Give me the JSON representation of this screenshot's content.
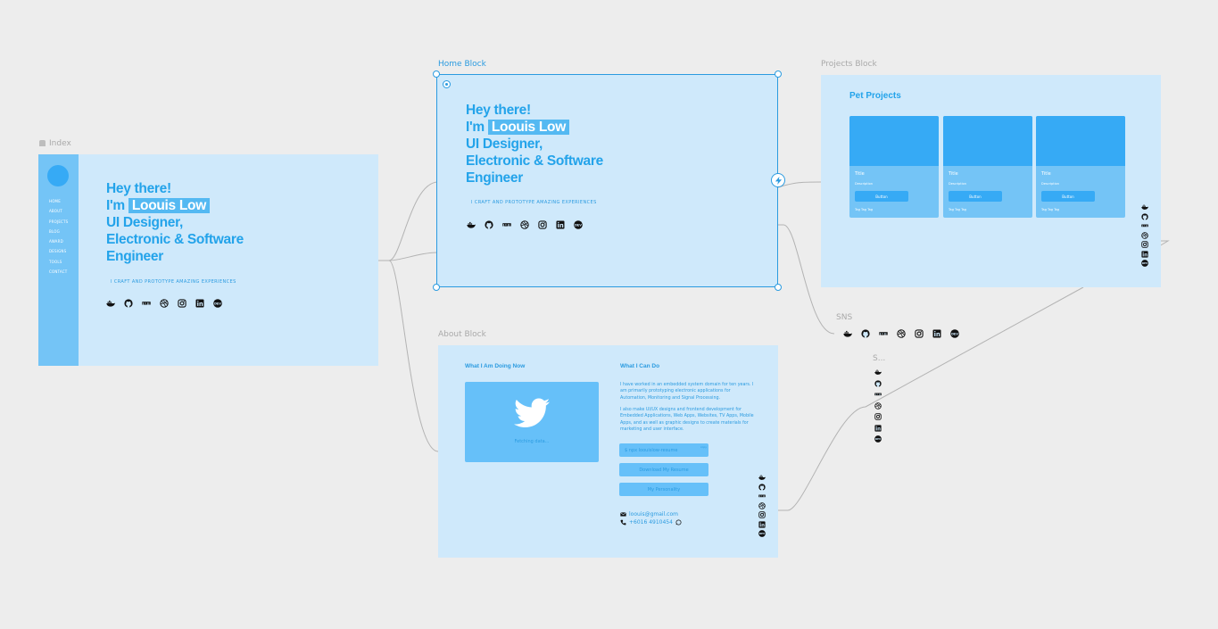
{
  "canvas": {
    "background": "#ededed",
    "frame_color": "#cfe9fb",
    "accent": "#23a3ea",
    "selection_color": "#2b9be0"
  },
  "frames": {
    "index": "Index",
    "home": "Home Block",
    "projects": "Projects Block",
    "about": "About Block",
    "sns": "SNS",
    "sns_small": "S..."
  },
  "hero": {
    "greeting": "Hey there!",
    "im": "I'm",
    "name": "Loouis Low",
    "role1": "UI Designer,",
    "role2": "Electronic & Software",
    "role3": "Engineer",
    "tagline": "I CRAFT AND PROTOTYPE AMAZING EXPERIENCES"
  },
  "index_nav": [
    "HOME",
    "ABOUT",
    "PROJECTS",
    "BLOG",
    "AWARD",
    "DESIGNS",
    "TOOLS",
    "CONTACT"
  ],
  "sns_icons": [
    "docker-icon",
    "github-icon",
    "npm-icon",
    "dribbble-icon",
    "instagram-icon",
    "linkedin-icon",
    "dev-icon"
  ],
  "projects": {
    "title": "Pet Projects",
    "cards": [
      {
        "title": "Title",
        "description": "Description",
        "button": "Button",
        "tags": "Tag Tag Tag"
      },
      {
        "title": "Title",
        "description": "Description",
        "button": "Button",
        "tags": "Tag Tag Tag"
      },
      {
        "title": "Title",
        "description": "Description",
        "button": "Button",
        "tags": "Tag Tag Tag"
      }
    ]
  },
  "about": {
    "left_heading": "What I Am Doing Now",
    "twitter_status": "Fetching data...",
    "right_heading": "What I Can Do",
    "para1": "I have worked in an embedded system domain for ten years. I am primarily prototyping electronic applications for Automation, Monitoring and Signal Processing.",
    "para2": "I also make UI/UX designs and frontend development for Embedded Applications, Web Apps, Websites, TV Apps, Mobile Apps, and as well as graphic designs to create materials for marketing and user interface.",
    "cmd_button": "$ npx loouislow-resume",
    "copy_label": "copy",
    "download_button": "Download My Resume",
    "personality_button": "My Personality",
    "email": "loouis@gmail.com",
    "phone": "+6016 4910454"
  }
}
